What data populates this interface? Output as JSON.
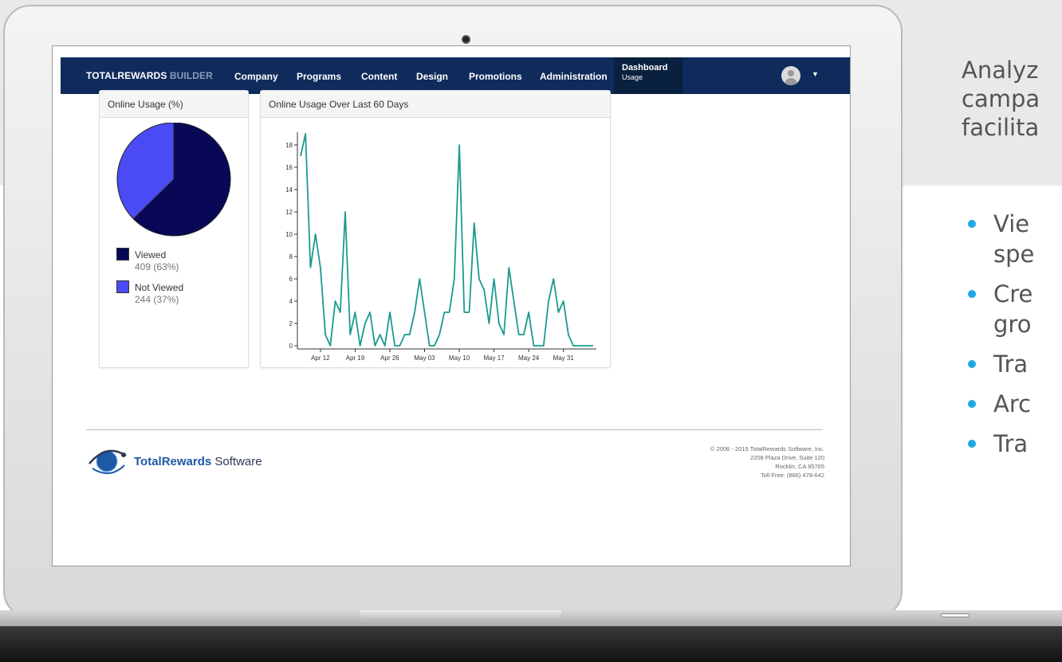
{
  "slide": {
    "title_lines": [
      "Analyz",
      "campa",
      "facilita"
    ],
    "bullets": [
      "Vie\nspe",
      "Cre\ngro",
      "Tra",
      "Arc",
      "Tra"
    ],
    "accent_color": "#1ca9e6"
  },
  "nav": {
    "brand_main": "TOTALREWARDS",
    "brand_sub": "BUILDER",
    "items": [
      "Company",
      "Programs",
      "Content",
      "Design",
      "Promotions",
      "Administration"
    ],
    "active_title": "Dashboard",
    "active_subtitle": "Usage",
    "avatar_icon": "user-avatar-icon",
    "caret_icon": "caret-down-icon",
    "bar_color": "#0f2b5b"
  },
  "pie_panel": {
    "title": "Online Usage (%)",
    "legend": [
      {
        "label": "Viewed",
        "value": "409 (63%)",
        "color": "#080857"
      },
      {
        "label": "Not Viewed",
        "value": "244 (37%)",
        "color": "#4b4bf5"
      }
    ]
  },
  "line_panel": {
    "title": "Online Usage Over Last 60 Days"
  },
  "chart_data": [
    {
      "type": "pie",
      "title": "Online Usage (%)",
      "labels": [
        "Viewed",
        "Not Viewed"
      ],
      "values": [
        409,
        244
      ],
      "percent_labels": [
        "63%",
        "37%"
      ],
      "colors": [
        "#080857",
        "#4b4bf5"
      ]
    },
    {
      "type": "line",
      "title": "Online Usage Over Last 60 Days",
      "x_tick_labels": [
        "Apr 12",
        "Apr 19",
        "Apr 26",
        "May 03",
        "May 10",
        "May 17",
        "May 24",
        "May 31"
      ],
      "y_ticks": [
        0,
        2,
        4,
        6,
        8,
        10,
        12,
        14,
        16,
        18
      ],
      "ylim": [
        0,
        19
      ],
      "x_first_date": "Apr 8",
      "series": [
        {
          "color": "#1a9a8f",
          "values": [
            17,
            19,
            7,
            10,
            7,
            1,
            0,
            4,
            3,
            12,
            1,
            3,
            0,
            2,
            3,
            0,
            1,
            0,
            3,
            0,
            0,
            1,
            1,
            3,
            6,
            3,
            0,
            0,
            1,
            3,
            3,
            6,
            18,
            3,
            3,
            11,
            6,
            5,
            2,
            6,
            2,
            1,
            7,
            4,
            1,
            1,
            3,
            0,
            0,
            0,
            4,
            6,
            3,
            4,
            1,
            0,
            0,
            0,
            0,
            0
          ]
        }
      ]
    }
  ],
  "footer": {
    "logo_icon": "totalrewards-globe-logo-icon",
    "brand_bold": "TotalRewards",
    "brand_rest": " Software",
    "lines": [
      "© 2006 - 2015 TotalRewards Software, Inc.",
      "2208 Plaza Drive, Suite 120",
      "Rocklin, CA 95765",
      "Toll Free: (866) 478-642"
    ]
  }
}
